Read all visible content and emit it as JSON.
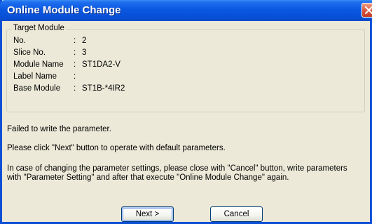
{
  "window": {
    "title": "Online Module Change"
  },
  "target_module": {
    "legend": "Target Module",
    "rows": [
      {
        "label": "No.",
        "colon": ":",
        "value": "2"
      },
      {
        "label": "Slice No.",
        "colon": ":",
        "value": "3"
      },
      {
        "label": "Module Name",
        "colon": ":",
        "value": "ST1DA2-V"
      },
      {
        "label": "Label Name",
        "colon": ":",
        "value": ""
      },
      {
        "label": "Base Module",
        "colon": ":",
        "value": "ST1B-*4IR2"
      }
    ]
  },
  "messages": {
    "line1": "Failed to write the parameter.",
    "line2": "Please click \"Next\" button to operate with default parameters.",
    "line3": "In case of changing the parameter settings, please close with \"Cancel\" button, write parameters",
    "line4": "with \"Parameter Setting\" and after that execute \"Online Module Change\" again."
  },
  "buttons": {
    "next": "Next >",
    "cancel": "Cancel"
  },
  "icons": {
    "close": "close-icon"
  },
  "colors": {
    "titlebar": "#0a58e0",
    "close_button": "#d9533a",
    "dialog_background": "#ece9d8"
  }
}
